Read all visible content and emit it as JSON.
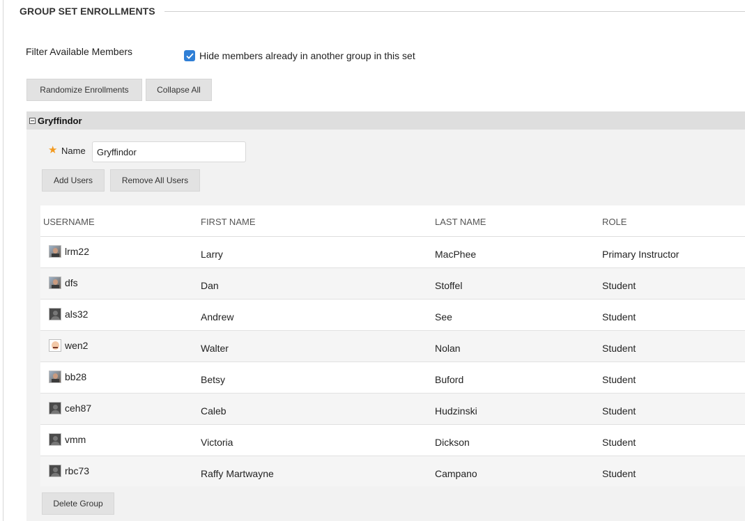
{
  "section": {
    "title": "GROUP SET ENROLLMENTS"
  },
  "filter": {
    "label": "Filter Available Members",
    "checkbox_label": "Hide members already in another group in this set",
    "checked": true
  },
  "actions": {
    "randomize": "Randomize Enrollments",
    "collapse_all": "Collapse All"
  },
  "group": {
    "title": "Gryffindor",
    "name_label": "Name",
    "name_value": "Gryffindor",
    "add_users": "Add Users",
    "remove_all_users": "Remove All Users",
    "delete_group": "Delete Group",
    "columns": [
      "USERNAME",
      "FIRST NAME",
      "LAST NAME",
      "ROLE"
    ],
    "members": [
      {
        "username": "lrm22",
        "first": "Larry",
        "last": "MacPhee",
        "role": "Primary Instructor",
        "avatar": "photo-avatar"
      },
      {
        "username": "dfs",
        "first": "Dan",
        "last": "Stoffel",
        "role": "Student",
        "avatar": "photo-avatar"
      },
      {
        "username": "als32",
        "first": "Andrew",
        "last": "See",
        "role": "Student",
        "avatar": "default-avatar"
      },
      {
        "username": "wen2",
        "first": "Walter",
        "last": "Nolan",
        "role": "Student",
        "avatar": "cartoon-avatar"
      },
      {
        "username": "bb28",
        "first": "Betsy",
        "last": "Buford",
        "role": "Student",
        "avatar": "photo-avatar"
      },
      {
        "username": "ceh87",
        "first": "Caleb",
        "last": "Hudzinski",
        "role": "Student",
        "avatar": "default-avatar"
      },
      {
        "username": "vmm",
        "first": "Victoria",
        "last": "Dickson",
        "role": "Student",
        "avatar": "default-avatar"
      },
      {
        "username": "rbc73",
        "first": "Raffy Martwayne",
        "last": "Campano",
        "role": "Student",
        "avatar": "default-avatar"
      }
    ]
  },
  "colors": {
    "checkbox": "#2f7fd6",
    "required_star": "#f39a1f",
    "button_bg": "#e2e2e2",
    "panel_bg": "#f2f2f2"
  }
}
